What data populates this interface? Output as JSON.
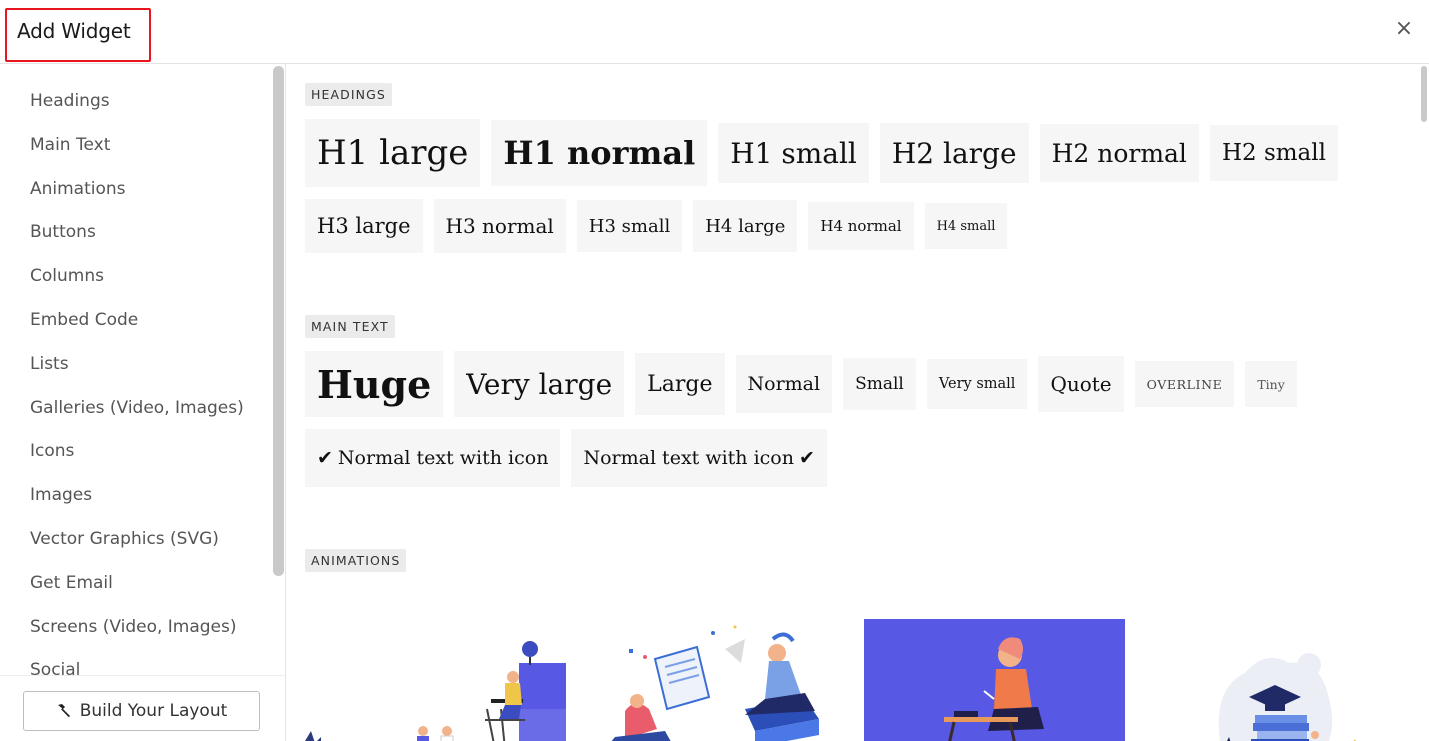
{
  "header": {
    "title": "Add Widget",
    "close_glyph": "×"
  },
  "sidebar": {
    "items": [
      "Headings",
      "Main Text",
      "Animations",
      "Buttons",
      "Columns",
      "Embed Code",
      "Lists",
      "Galleries (Video, Images)",
      "Icons",
      "Images",
      "Vector Graphics (SVG)",
      "Get Email",
      "Screens (Video, Images)",
      "Social"
    ],
    "build_button": {
      "label": "Build Your Layout",
      "icon": "hammer-icon"
    }
  },
  "sections": {
    "headings": {
      "label": "HEADINGS",
      "row1": [
        "H1 large",
        "H1 normal",
        "H1 small",
        "H2 large",
        "H2 normal",
        "H2 small"
      ],
      "row2": [
        "H3 large",
        "H3 normal",
        "H3 small",
        "H4 large",
        "H4 normal",
        "H4 small"
      ]
    },
    "main_text": {
      "label": "MAIN TEXT",
      "row1": [
        "Huge",
        "Very large",
        "Large",
        "Normal",
        "Small",
        "Very small",
        "Quote",
        "OVERLINE",
        "Tiny"
      ],
      "row2": [
        "Normal text with icon",
        "Normal text with icon"
      ],
      "check_glyph": "✔"
    },
    "animations": {
      "label": "ANIMATIONS"
    }
  },
  "colors": {
    "accent_red": "#e8141e",
    "tile_bg": "#f6f6f6",
    "label_bg": "#ebebeb",
    "anim_purple": "#5758e3"
  }
}
